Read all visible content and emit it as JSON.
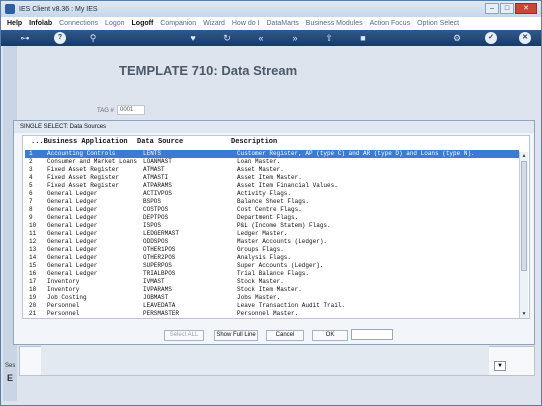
{
  "window": {
    "title": "IES Client v8.36 : My IES"
  },
  "menu": [
    {
      "label": "Help",
      "strong": true
    },
    {
      "label": "Infolab",
      "strong": true
    },
    {
      "label": "Connections",
      "strong": false
    },
    {
      "label": "Logon",
      "strong": false
    },
    {
      "label": "Logoff",
      "strong": true
    },
    {
      "label": "Companion",
      "strong": false
    },
    {
      "label": "Wizard",
      "strong": false
    },
    {
      "label": "How do I",
      "strong": false
    },
    {
      "label": "DataMarts",
      "strong": false
    },
    {
      "label": "Business Modules",
      "strong": false
    },
    {
      "label": "Action Focus",
      "strong": false
    },
    {
      "label": "Option Select",
      "strong": false
    }
  ],
  "page": {
    "heading": "TEMPLATE 710: Data Stream",
    "tag_label": "TAG #",
    "tag_value": "0001"
  },
  "dialog": {
    "title": "SINGLE SELECT: Data Sources",
    "headers": {
      "app": "...Business Application",
      "source": "Data Source",
      "desc": "Description"
    },
    "rows": [
      {
        "n": "1",
        "app": "Accounting Controls",
        "src": "LENTS",
        "desc": "Customer Register, AP (type C) and AR (type D) and Loans (type N)."
      },
      {
        "n": "2",
        "app": "Consumer and Market Loans",
        "src": "LOANMAST",
        "desc": "Loan Master."
      },
      {
        "n": "3",
        "app": "Fixed Asset Register",
        "src": "ATMAST",
        "desc": "Asset Master."
      },
      {
        "n": "4",
        "app": "Fixed Asset Register",
        "src": "ATMASTI",
        "desc": "Asset Item Master."
      },
      {
        "n": "5",
        "app": "Fixed Asset Register",
        "src": "ATPARAMS",
        "desc": "Asset Item Financial Values."
      },
      {
        "n": "6",
        "app": "General Ledger",
        "src": "ACTIVPOS",
        "desc": "Activity Flags."
      },
      {
        "n": "7",
        "app": "General Ledger",
        "src": "BSPOS",
        "desc": "Balance Sheet Flags."
      },
      {
        "n": "8",
        "app": "General Ledger",
        "src": "COSTPOS",
        "desc": "Cost Centre Flags."
      },
      {
        "n": "9",
        "app": "General Ledger",
        "src": "DEPTPOS",
        "desc": "Department Flags."
      },
      {
        "n": "10",
        "app": "General Ledger",
        "src": "ISPOS",
        "desc": "P&L (Income Statem) Flags."
      },
      {
        "n": "11",
        "app": "General Ledger",
        "src": "LEDGERMAST",
        "desc": "Ledger Master."
      },
      {
        "n": "12",
        "app": "General Ledger",
        "src": "ODDSPOS",
        "desc": "Master Accounts (Ledger)."
      },
      {
        "n": "13",
        "app": "General Ledger",
        "src": "OTHER1POS",
        "desc": "Groups Flags."
      },
      {
        "n": "14",
        "app": "General Ledger",
        "src": "OTHER2POS",
        "desc": "Analysis Flags."
      },
      {
        "n": "15",
        "app": "General Ledger",
        "src": "SUPERPOS",
        "desc": "Super Accounts (Ledger)."
      },
      {
        "n": "16",
        "app": "General Ledger",
        "src": "TRIALBPOS",
        "desc": "Trial Balance Flags."
      },
      {
        "n": "17",
        "app": "Inventory",
        "src": "IVMAST",
        "desc": "Stock Master."
      },
      {
        "n": "18",
        "app": "Inventory",
        "src": "IVPARAMS",
        "desc": "Stock Item Master."
      },
      {
        "n": "19",
        "app": "Job Costing",
        "src": "JOBMAST",
        "desc": "Jobs Master."
      },
      {
        "n": "20",
        "app": "Personnel",
        "src": "LEAVEDATA",
        "desc": "Leave Transaction Audit Trail."
      },
      {
        "n": "21",
        "app": "Personnel",
        "src": "PERSMASTER",
        "desc": "Personnel Master."
      }
    ],
    "selected_index": 0,
    "buttons": {
      "select_all": "Select ALL",
      "show_full_line": "Show Full Line",
      "cancel": "Cancel",
      "ok": "OK"
    }
  },
  "side": {
    "label": "Ses",
    "letter": "E"
  },
  "colors": {
    "toolbar": "#173a66",
    "selection": "#3a7bd5",
    "heading": "#4c5966"
  }
}
